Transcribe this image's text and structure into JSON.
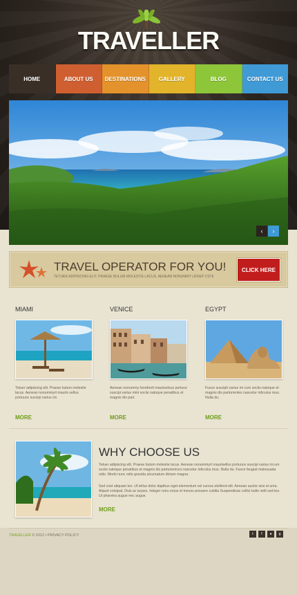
{
  "logo": {
    "text": "TRAVELLER"
  },
  "nav": [
    {
      "label": "Home",
      "color": "#3a2f27"
    },
    {
      "label": "About Us",
      "color": "#cf5f31"
    },
    {
      "label": "Destinations",
      "color": "#e4922b"
    },
    {
      "label": "Gallery",
      "color": "#e2b42b"
    },
    {
      "label": "Blog",
      "color": "#8ec63a"
    },
    {
      "label": "Contact Us",
      "color": "#3f9ad6"
    }
  ],
  "slider": {
    "prev_icon": "chevron-left",
    "next_icon": "chevron-right"
  },
  "banner": {
    "title": "TRAVEL OPERATOR FOR YOU!",
    "subtitle": "TETUER ADIPISCING ELIT. PRAESE BULUM MOLESTIE LACUS. AENEAN NONUMMY LROEP CSTE",
    "button": "CLICK HERE"
  },
  "destinations": [
    {
      "name": "MIAMI",
      "text": "Totuer adipiscing elit. Praese bulum molestie lacus. Aenean nonummyrt maurls sellus portuuce suscipi varius mi.",
      "more": "MORE"
    },
    {
      "name": "VENICE",
      "text": "Aenean nonummy hendrerit mauriselsus portuce suscipi varius mini sociis natoque penatibus et magnis dis part.",
      "more": "MORE"
    },
    {
      "name": "EGYPT",
      "text": "Fusce suscipit varius mi cum sociis natoque et magnis dis parturientes nascetur ridiculus mus. Nulla du.",
      "more": "MORE"
    }
  ],
  "why": {
    "title": "WHY CHOOSE US",
    "para1": "Tetuer adipiscing elit. Praese bulum molestie lacus. Aenean nonummyrt maurisellus portuuce suscipi varius mi um sociis natoque penatibus et magnis dis parturientces nascetur ridiculus mus. Nulla du. Fusce feugiat malesuada odio. Morbi nunc odio gravida atcumatum dictum magna.",
    "para2": "Sed cnet aliquam leo. Ut tellus dolor dapibus eget elementum vel cursus eleifend elit. Aenean auctor wisi et uma. Alquet volutpat. Duis ac turpes. Integer rutru ectus et tneces posuere cubilia Suspendisse collici tudin velit sed leo. Ut pharetra augue nec augue.",
    "more": "MORE"
  },
  "footer": {
    "brand": "TRAVELLER",
    "copy": "© 2012 • PRIVACY POLICY",
    "social": [
      "twitter-icon",
      "facebook-icon",
      "rss-icon",
      "google-icon"
    ]
  }
}
